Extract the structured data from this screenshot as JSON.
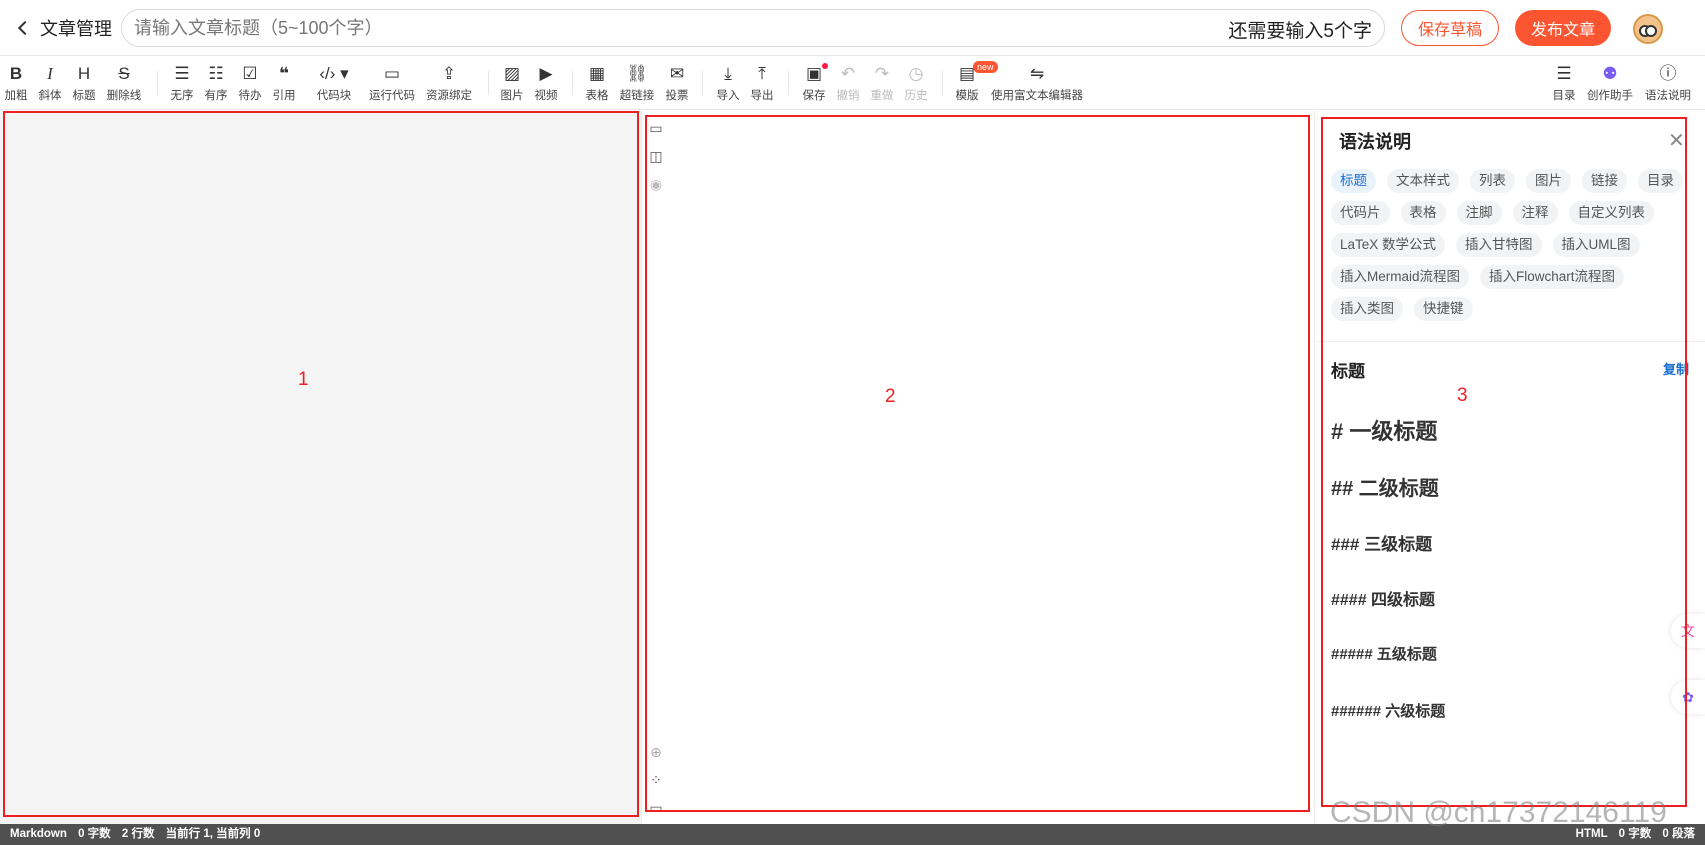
{
  "header": {
    "back_label": "文章管理",
    "title_placeholder": "请输入文章标题（5~100个字）",
    "title_value": "",
    "counter": "还需要输入5个字",
    "save_draft": "保存草稿",
    "publish": "发布文章"
  },
  "toolbar": {
    "bold": "加粗",
    "italic": "斜体",
    "heading": "标题",
    "strike": "删除线",
    "ul": "无序",
    "ol": "有序",
    "todo": "待办",
    "quote": "引用",
    "code": "代码块",
    "run": "运行代码",
    "resource": "资源绑定",
    "image": "图片",
    "video": "视频",
    "table": "表格",
    "link": "超链接",
    "vote": "投票",
    "import": "导入",
    "export": "导出",
    "save": "保存",
    "undo": "撤销",
    "redo": "重做",
    "history": "历史",
    "template": "模版",
    "template_badge": "new",
    "richtext": "使用富文本编辑器",
    "toc": "目录",
    "assistant": "创作助手",
    "syntax": "语法说明"
  },
  "labels": {
    "box1": "1",
    "box2": "2",
    "box3": "3"
  },
  "syntax_panel": {
    "title": "语法说明",
    "chips": [
      "标题",
      "文本样式",
      "列表",
      "图片",
      "链接",
      "目录",
      "代码片",
      "表格",
      "注脚",
      "注释",
      "自定义列表",
      "LaTeX 数学公式",
      "插入甘特图",
      "插入UML图",
      "插入Mermaid流程图",
      "插入Flowchart流程图",
      "插入类图",
      "快捷键"
    ],
    "section_title": "标题",
    "copy": "复制",
    "headings": [
      "# 一级标题",
      "## 二级标题",
      "### 三级标题",
      "#### 四级标题",
      "##### 五级标题",
      "###### 六级标题"
    ]
  },
  "status": {
    "mode": "Markdown",
    "chars": "0 字数",
    "lines": "2 行数",
    "cursor": "当前行 1, 当前列 0",
    "right_mode": "HTML",
    "right_chars": "0 字数",
    "paragraphs": "0 段落"
  },
  "watermark": "CSDN @ch17372146119",
  "colors": {
    "accent": "#fc5531",
    "link": "#1a6fd0",
    "annotation": "#ef1f1f"
  }
}
